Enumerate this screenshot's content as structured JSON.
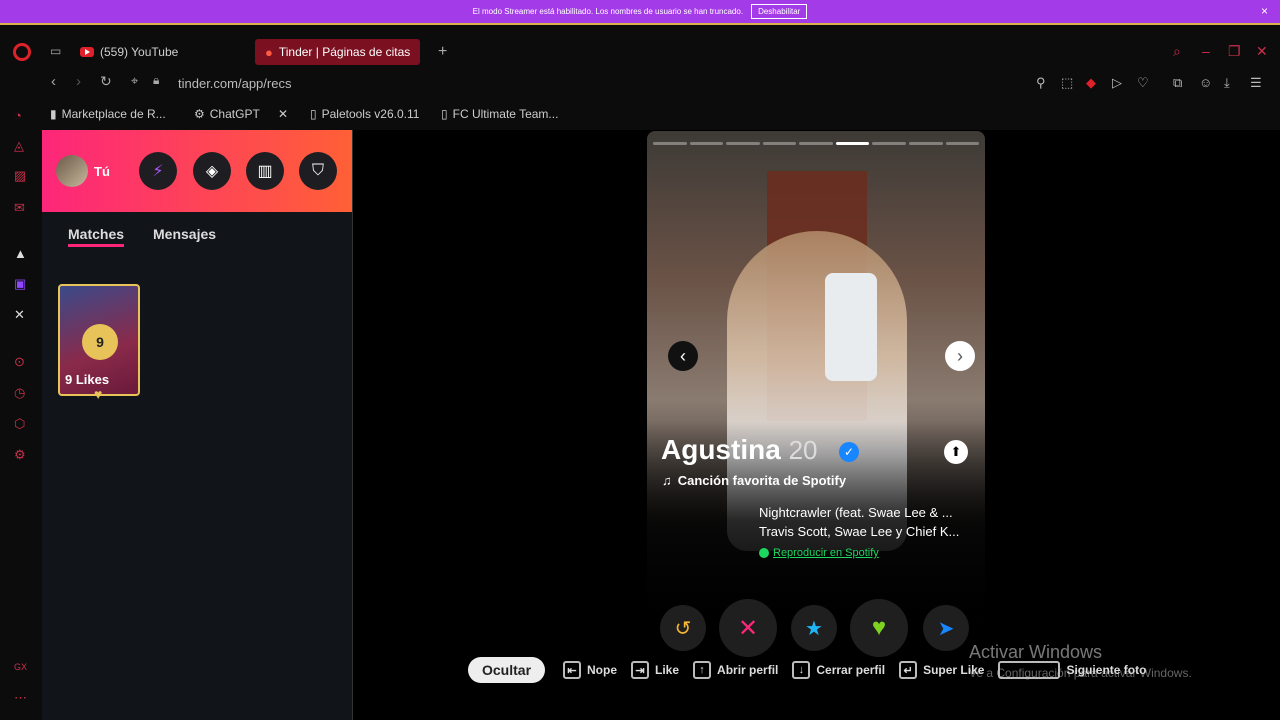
{
  "banner": {
    "text": "El modo Streamer está habilitado. Los nombres de usuario se han truncado.",
    "button": "Deshabilitar"
  },
  "tabs": [
    {
      "label": "(559) YouTube",
      "icon": "youtube-icon"
    },
    {
      "label": "Tinder | Páginas de citas",
      "icon": "tinder-flame-icon"
    }
  ],
  "address": {
    "url": "tinder.com/app/recs"
  },
  "bookmarks": [
    {
      "label": "Marketplace de R...",
      "icon": "bookmark-icon"
    },
    {
      "label": "ChatGPT",
      "icon": "chatgpt-icon"
    },
    {
      "label": "",
      "icon": "x-icon"
    },
    {
      "label": "Paletools v26.0.11",
      "icon": "page-icon"
    },
    {
      "label": "FC Ultimate Team...",
      "icon": "page-icon"
    }
  ],
  "panel": {
    "you_label": "Tú",
    "tabs": [
      "Matches",
      "Mensajes"
    ],
    "likes": {
      "count": "9",
      "label": "9 Likes"
    }
  },
  "profile": {
    "name": "Agustina",
    "age": "20",
    "spotify_heading": "Canción favorita de Spotify",
    "song_title": "Nightcrawler (feat. Swae Lee & ...",
    "song_artist": "Travis Scott, Swae Lee y Chief K...",
    "spotify_link": "Reproducir en Spotify",
    "photo_count": 9,
    "current_photo": 6
  },
  "shortcuts": {
    "hide": "Ocultar",
    "items": [
      "Nope",
      "Like",
      "Abrir perfil",
      "Cerrar perfil",
      "Super Like",
      "Siguiente foto"
    ]
  },
  "watermark": {
    "line1": "Activar Windows",
    "line2": "Ve a Configuración para activar Windows."
  },
  "colors": {
    "tinder_start": "#fd267a",
    "tinder_end": "#ff6036",
    "streamer_banner": "#a43be8",
    "opera_red": "#e0202a"
  }
}
